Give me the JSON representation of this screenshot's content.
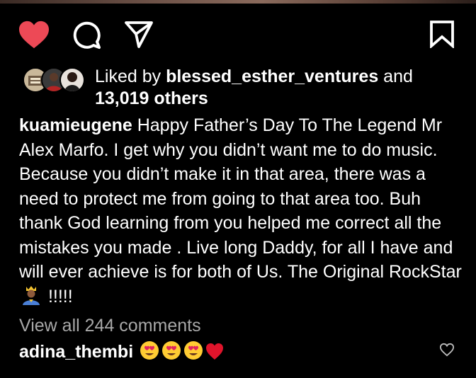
{
  "post": {
    "liked_by_prefix": "Liked by ",
    "liked_by_user": "blessed_esther_ventures",
    "liked_by_and": " and",
    "liked_by_count": "13,019 others",
    "caption_user": "kuamieugene",
    "caption_text": " Happy Father’s Day To The Legend Mr Alex Marfo. I get why you didn’t want me to do music. Because you didn’t make it in that area, there was a need to protect me from going to that area too. Buh thank God learning from you helped me correct all the mistakes you made . Live long Daddy, for all I have and will ever achieve is for both of Us. The Original RockStar",
    "caption_tail": " !!!!!",
    "view_comments": "View all 244 comments"
  },
  "comment": {
    "user": "adina_thembi"
  },
  "actions": {
    "like_icon": "heart-filled-icon",
    "comment_icon": "comment-bubble-icon",
    "share_icon": "paper-plane-icon",
    "save_icon": "bookmark-icon"
  },
  "colors": {
    "background": "#000000",
    "like_red": "#ed4956",
    "muted_text": "#a8a8a8"
  }
}
